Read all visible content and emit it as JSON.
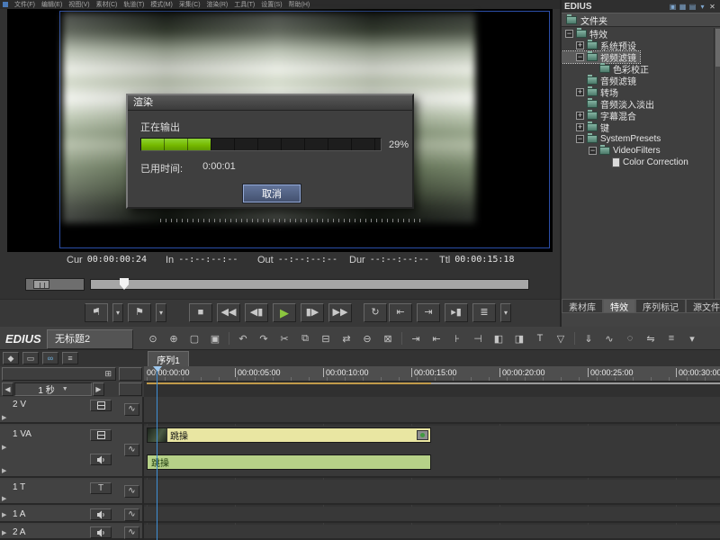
{
  "menubar": {
    "items": [
      "文件(F)",
      "编辑(E)",
      "视图(V)",
      "素材(C)",
      "轨道(T)",
      "模式(M)",
      "采集(C)",
      "渲染(R)",
      "工具(T)",
      "设置(S)",
      "帮助(H)"
    ]
  },
  "monitor": {
    "timecode": {
      "fields": [
        {
          "label": "Cur",
          "value": "00:00:00:24"
        },
        {
          "label": "In",
          "value": "--:--:--:--"
        },
        {
          "label": "Out",
          "value": "--:--:--:--"
        },
        {
          "label": "Dur",
          "value": "--:--:--:--"
        },
        {
          "label": "Ttl",
          "value": "00:00:15:18"
        }
      ]
    }
  },
  "transport": {
    "buttons": [
      {
        "name": "set-mark-in",
        "glyph": "⚑"
      },
      {
        "name": "set-mark-in-menu",
        "glyph": "▾"
      },
      {
        "name": "set-mark-out",
        "glyph": "⚑"
      },
      {
        "name": "set-mark-out-menu",
        "glyph": "▾"
      },
      {
        "name": "stop",
        "glyph": "■"
      },
      {
        "name": "rewind",
        "glyph": "◀◀"
      },
      {
        "name": "previous-frame",
        "glyph": "◀▮"
      },
      {
        "name": "play",
        "glyph": "▶"
      },
      {
        "name": "next-frame",
        "glyph": "▮▶"
      },
      {
        "name": "fast-forward",
        "glyph": "▶▶"
      },
      {
        "name": "loop-play",
        "glyph": "↻"
      },
      {
        "name": "loop-menu",
        "glyph": "▾"
      },
      {
        "name": "goto-in",
        "glyph": "⇤"
      },
      {
        "name": "goto-out",
        "glyph": "⇥"
      },
      {
        "name": "play-around-cursor",
        "glyph": "▸▮"
      },
      {
        "name": "device-output",
        "glyph": "≣"
      },
      {
        "name": "device-menu",
        "glyph": "▾"
      }
    ]
  },
  "dialog": {
    "title": "渲染",
    "status": "正在输出",
    "progress_percent": 29,
    "progress_label": "29%",
    "progress_style": "width:29%",
    "elapsed_label": "已用时间:",
    "elapsed_value": "0:00:01",
    "cancel_label": "取消"
  },
  "effects_panel": {
    "window_title": "EDIUS",
    "folder_label": "文件夹",
    "header_icons": [
      {
        "name": "dock-icon",
        "glyph": "▣"
      },
      {
        "name": "bin-palette-icon",
        "glyph": "▦"
      },
      {
        "name": "effect-palette-icon",
        "glyph": "▤"
      },
      {
        "name": "options-icon",
        "glyph": "▾"
      },
      {
        "name": "close-icon",
        "glyph": "✕"
      }
    ],
    "tree": [
      {
        "label": "特效"
      },
      {
        "label": "系统预设"
      },
      {
        "label": "视频滤镜"
      },
      {
        "label": "色彩校正"
      },
      {
        "label": "音频滤镜"
      },
      {
        "label": "转场"
      },
      {
        "label": "音频淡入淡出"
      },
      {
        "label": "字幕混合"
      },
      {
        "label": "键"
      },
      {
        "label": "SystemPresets"
      },
      {
        "label": "VideoFilters"
      },
      {
        "label": "Color Correction"
      }
    ],
    "tabs": [
      {
        "label": "素材库"
      },
      {
        "label": "特效"
      },
      {
        "label": "序列标记"
      },
      {
        "label": "源文件浏览"
      }
    ]
  },
  "timeline": {
    "app_logo": "EDIUS",
    "doc_tab": "无标题2",
    "sequence_tab": "序列1",
    "zoom_value": "1 秒",
    "ruler_labels": [
      "00:00:00:00",
      "00:00:05:00",
      "00:00:10:00",
      "00:00:15:00",
      "00:00:20:00",
      "00:00:25:00",
      "00:00:30:00"
    ],
    "track_toolbar": [
      {
        "name": "track-patch-icon",
        "glyph": "◆"
      },
      {
        "name": "sync-mode-icon",
        "glyph": "▭"
      },
      {
        "name": "ripple-mode-icon",
        "glyph": "∞"
      },
      {
        "name": "track-options-icon",
        "glyph": "≡"
      }
    ],
    "toolbar": [
      {
        "name": "capture",
        "glyph": "⊙"
      },
      {
        "name": "add-clip",
        "glyph": "⊕"
      },
      {
        "name": "new-sequence",
        "glyph": "▢"
      },
      {
        "name": "save",
        "glyph": "▣"
      },
      {
        "name": "undo",
        "glyph": "↶"
      },
      {
        "name": "redo",
        "glyph": "↷"
      },
      {
        "name": "cut",
        "glyph": "✂"
      },
      {
        "name": "copy",
        "glyph": "⧉"
      },
      {
        "name": "paste",
        "glyph": "⊟"
      },
      {
        "name": "replace",
        "glyph": "⇄"
      },
      {
        "name": "ripple-delete",
        "glyph": "⊖"
      },
      {
        "name": "delete",
        "glyph": "⊠"
      },
      {
        "name": "set-in",
        "glyph": "⇥"
      },
      {
        "name": "set-out",
        "glyph": "⇤"
      },
      {
        "name": "add-cut-point",
        "glyph": "⊦"
      },
      {
        "name": "remove-cut-point",
        "glyph": "⊣"
      },
      {
        "name": "add-transition",
        "glyph": "◧"
      },
      {
        "name": "add-audio-fade",
        "glyph": "◨"
      },
      {
        "name": "add-title",
        "glyph": "T"
      },
      {
        "name": "add-marker",
        "glyph": "▽"
      },
      {
        "name": "export",
        "glyph": "⇓"
      },
      {
        "name": "mixer",
        "glyph": "∿"
      },
      {
        "name": "voice-over",
        "glyph": "◌"
      },
      {
        "name": "pan",
        "glyph": "⇋"
      },
      {
        "name": "settings",
        "glyph": "≡"
      },
      {
        "name": "more",
        "glyph": "▾"
      }
    ],
    "tracks": [
      {
        "name": "2 V"
      },
      {
        "name": "1 VA"
      },
      {
        "name": "1 T"
      },
      {
        "name": "1 A"
      },
      {
        "name": "2 A"
      }
    ],
    "title_track_glyph": "T",
    "clips": {
      "video_label": "跳操",
      "audio_label": "跳操"
    }
  }
}
